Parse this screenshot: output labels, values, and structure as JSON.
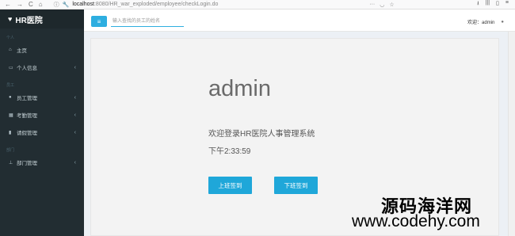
{
  "browser": {
    "url_host": "localhost",
    "url_rest": ":8080/HR_war_exploded/employee/checkLogin.do"
  },
  "sidebar": {
    "brand": "HR医院",
    "sections": [
      {
        "header": "个人",
        "items": [
          {
            "label": "主页",
            "icon": "home-icon",
            "has_arrow": false
          },
          {
            "label": "个人信息",
            "icon": "id-card-icon",
            "has_arrow": true
          }
        ]
      },
      {
        "header": "员工",
        "items": [
          {
            "label": "员工管理",
            "icon": "user-icon",
            "has_arrow": true
          },
          {
            "label": "考勤管理",
            "icon": "calendar-icon",
            "has_arrow": true
          },
          {
            "label": "请假管理",
            "icon": "bookmark-icon",
            "has_arrow": true
          }
        ]
      },
      {
        "header": "部门",
        "items": [
          {
            "label": "部门管理",
            "icon": "sitemap-icon",
            "has_arrow": true
          }
        ]
      }
    ]
  },
  "header": {
    "search_placeholder": "输入查找的员工的姓名",
    "welcome": "欢迎：admin"
  },
  "main": {
    "username": "admin",
    "greeting": "欢迎登录HR医院人事管理系统",
    "clock": "下午2:33:59",
    "check_in_label": "上班签到",
    "check_out_label": "下班签到"
  },
  "watermark": {
    "line1": "源码海洋网",
    "line2": "www.codehy.com"
  }
}
